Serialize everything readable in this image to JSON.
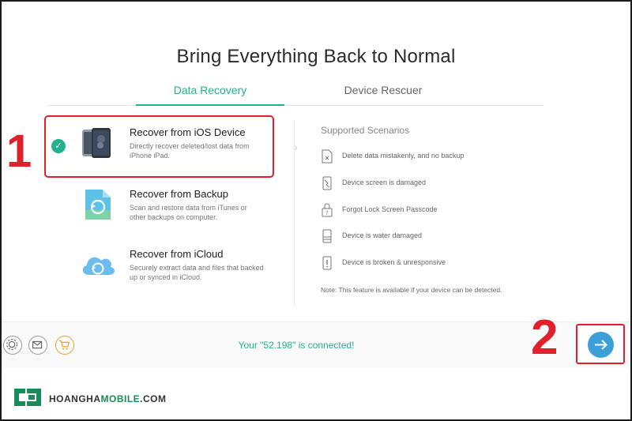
{
  "app": {
    "title": "Bring Everything Back to Normal"
  },
  "tabs": [
    {
      "label": "Data Recovery",
      "active": true
    },
    {
      "label": "Device Rescuer",
      "active": false
    }
  ],
  "options": [
    {
      "title": "Recover from iOS Device",
      "desc": "Directly recover deleted/lost data from iPhone iPad.",
      "selected": true,
      "icon": "ios-device-icon"
    },
    {
      "title": "Recover from Backup",
      "desc": "Scan and restore data from iTunes or other backups on computer.",
      "selected": false,
      "icon": "backup-file-icon"
    },
    {
      "title": "Recover from iCloud",
      "desc": "Securely extract data and files that backed up or synced in iCloud.",
      "selected": false,
      "icon": "icloud-icon"
    }
  ],
  "scenarios": {
    "title": "Supported Scenarios",
    "items": [
      {
        "text": "Delete data mistakenly, and no backup",
        "icon": "delete-file-icon"
      },
      {
        "text": "Device screen is damaged",
        "icon": "broken-screen-icon"
      },
      {
        "text": "Forgot Lock Screen Passcode",
        "icon": "passcode-icon"
      },
      {
        "text": "Device is water damaged",
        "icon": "water-damage-icon"
      },
      {
        "text": "Device is broken & unresponsive",
        "icon": "unresponsive-icon"
      }
    ],
    "note": "Note: This feature is available if your device can be detected."
  },
  "status": {
    "text": "Your \"52.198\" is connected!"
  },
  "annotations": {
    "step1": "1",
    "step2": "2"
  },
  "brand": {
    "part1": "HOANGHA",
    "part2": "MOBILE",
    "part3": ".COM"
  },
  "colors": {
    "accent": "#21b38f",
    "highlight": "#e0202a",
    "next_button": "#3d9fd8",
    "brand_green": "#1b8a5a"
  }
}
